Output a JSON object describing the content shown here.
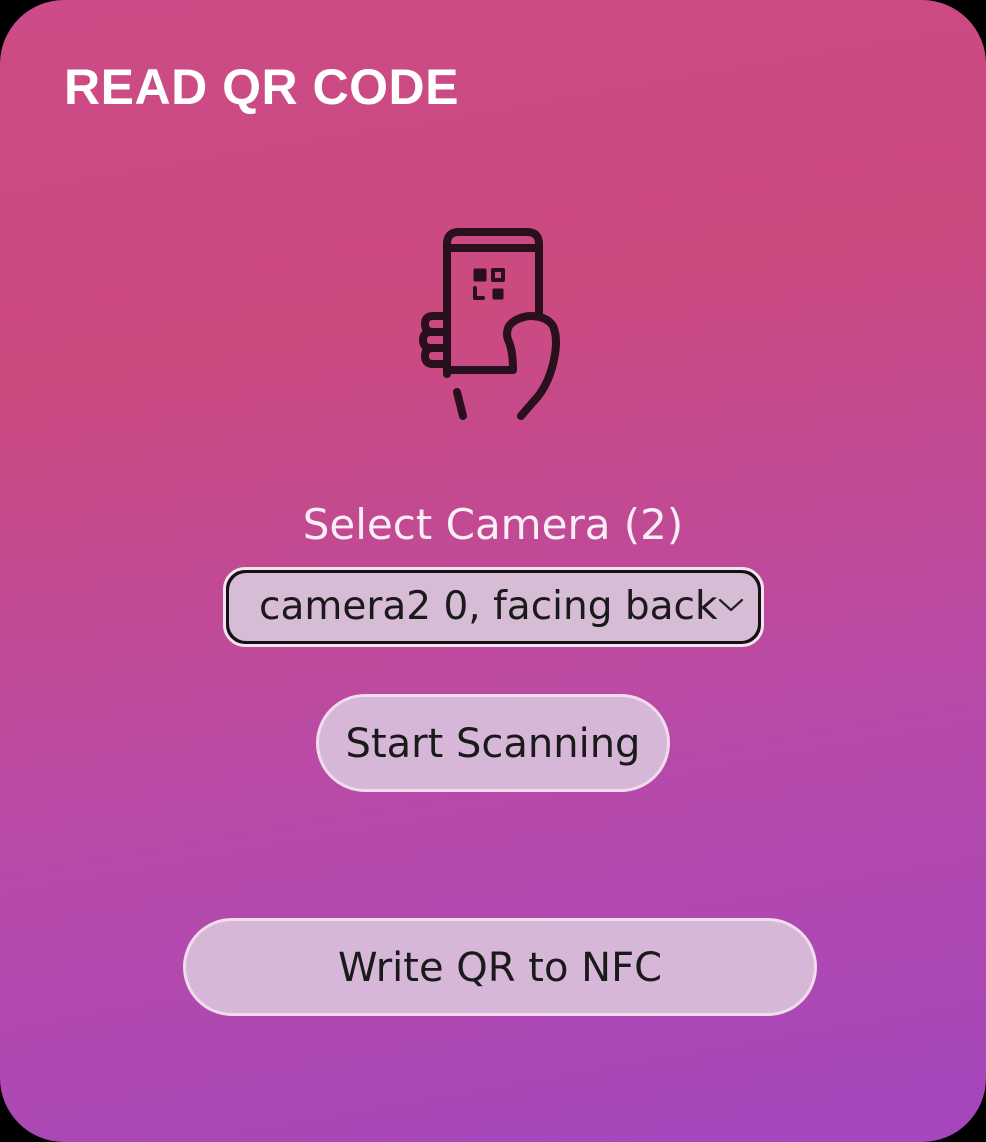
{
  "header": {
    "title": "READ QR CODE"
  },
  "illustration": {
    "icon": "phone-scan-qr-icon"
  },
  "camera": {
    "label": "Select Camera (2)",
    "selected": "camera2 0, facing back"
  },
  "actions": {
    "start_label": "Start Scanning",
    "nfc_label": "Write QR to NFC"
  },
  "colors": {
    "gradient_top": "#cd4b86",
    "gradient_bottom": "#a446bd",
    "button_bg": "#d6b7d8",
    "icon_stroke": "#2a0f1c"
  }
}
